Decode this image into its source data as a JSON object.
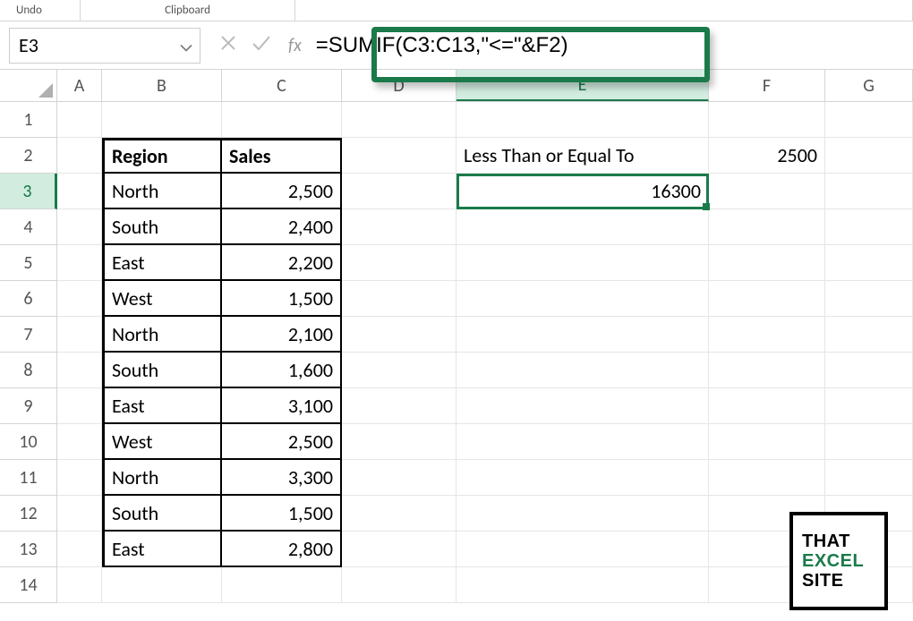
{
  "ribbon": {
    "undo": "Undo",
    "clipboard": "Clipboard",
    "font": ""
  },
  "formula_bar": {
    "name_box": "E3",
    "fx": "fx",
    "formula": "=SUMIF(C3:C13,\"<=\"&F2)"
  },
  "columns": [
    "A",
    "B",
    "C",
    "D",
    "E",
    "F",
    "G"
  ],
  "rows": [
    "1",
    "2",
    "3",
    "4",
    "5",
    "6",
    "7",
    "8",
    "9",
    "10",
    "11",
    "12",
    "13",
    "14"
  ],
  "headers": {
    "region": "Region",
    "sales": "Sales"
  },
  "table": [
    {
      "region": "North",
      "sales": "2,500"
    },
    {
      "region": "South",
      "sales": "2,400"
    },
    {
      "region": "East",
      "sales": "2,200"
    },
    {
      "region": "West",
      "sales": "1,500"
    },
    {
      "region": "North",
      "sales": "2,100"
    },
    {
      "region": "South",
      "sales": "1,600"
    },
    {
      "region": "East",
      "sales": "3,100"
    },
    {
      "region": "West",
      "sales": "2,500"
    },
    {
      "region": "North",
      "sales": "3,300"
    },
    {
      "region": "South",
      "sales": "1,500"
    },
    {
      "region": "East",
      "sales": "2,800"
    }
  ],
  "e2_label": "Less Than or Equal To",
  "f2_value": "2500",
  "e3_result": "16300",
  "active_cell": "E3",
  "watermark": {
    "l1": "THAT",
    "l2": "EXCEL",
    "l3": "SITE"
  }
}
